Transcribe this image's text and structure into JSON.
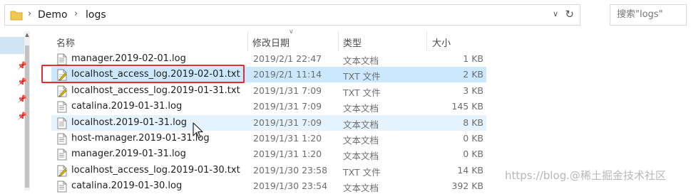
{
  "address": {
    "crumbs": [
      "Demo",
      "logs"
    ],
    "search_placeholder": "搜索\"logs\""
  },
  "columns": {
    "name": "名称",
    "date": "修改日期",
    "type": "类型",
    "size": "大小"
  },
  "files": [
    {
      "name": "manager.2019-02-01.log",
      "date": "2019/2/1 22:47",
      "type": "文本文档",
      "size": "1 KB",
      "icon": "text-file-icon"
    },
    {
      "name": "localhost_access_log.2019-02-01.txt",
      "date": "2019/2/1 11:14",
      "type": "TXT 文件",
      "size": "2 KB",
      "icon": "txt-file-icon"
    },
    {
      "name": "localhost_access_log.2019-01-31.txt",
      "date": "2019/1/31 7:09",
      "type": "TXT 文件",
      "size": "3 KB",
      "icon": "txt-file-icon"
    },
    {
      "name": "catalina.2019-01-31.log",
      "date": "2019/1/31 7:09",
      "type": "文本文档",
      "size": "145 KB",
      "icon": "text-file-icon"
    },
    {
      "name": "localhost.2019-01-31.log",
      "date": "2019/1/31 7:09",
      "type": "文本文档",
      "size": "8 KB",
      "icon": "text-file-icon"
    },
    {
      "name": "host-manager.2019-01-31.log",
      "date": "2019/1/31 1:20",
      "type": "文本文档",
      "size": "0 KB",
      "icon": "text-file-icon"
    },
    {
      "name": "manager.2019-01-31.log",
      "date": "2019/1/31 1:20",
      "type": "文本文档",
      "size": "0 KB",
      "icon": "text-file-icon"
    },
    {
      "name": "localhost_access_log.2019-01-30.txt",
      "date": "2019/1/30 23:58",
      "type": "TXT 文件",
      "size": "14 KB",
      "icon": "txt-file-icon"
    },
    {
      "name": "catalina.2019-01-30.log",
      "date": "2019/1/30 23:54",
      "type": "文本文档",
      "size": "392 KB",
      "icon": "text-file-icon"
    }
  ],
  "selected_index": 1,
  "hover_index": 4,
  "watermark": "https://blog.@稀土掘金技术社区",
  "colors": {
    "selection": "#cce8ff",
    "hover": "#e5f3ff",
    "highlight_box": "#e8292b"
  }
}
